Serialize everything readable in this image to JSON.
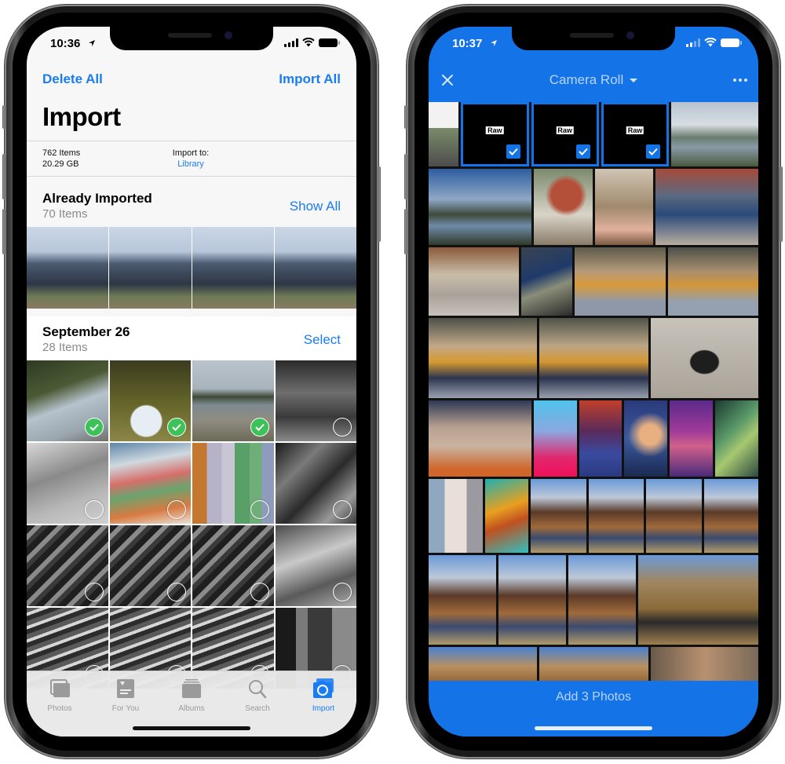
{
  "left_phone": {
    "status": {
      "time": "10:36",
      "location_icon": "location-arrow-icon"
    },
    "nav": {
      "left_label": "Delete All",
      "right_label": "Import All"
    },
    "title": "Import",
    "info": {
      "item_count": "762 Items",
      "size": "20.29 GB",
      "import_to_label": "Import to:",
      "import_to_value": "Library"
    },
    "already_imported": {
      "title": "Already Imported",
      "count": "70 Items",
      "action": "Show All",
      "thumbnails": [
        "family-group",
        "family-group",
        "family-group",
        "family-group"
      ]
    },
    "section": {
      "title": "September 26",
      "count": "28 Items",
      "action": "Select",
      "photos": [
        {
          "subject": "trees-sky",
          "selected": true
        },
        {
          "subject": "tree-canopy",
          "selected": true
        },
        {
          "subject": "lake-shore",
          "selected": true
        },
        {
          "subject": "bw-street",
          "selected": false
        },
        {
          "subject": "bw-market",
          "selected": false
        },
        {
          "subject": "macarons",
          "selected": false
        },
        {
          "subject": "macarons-top",
          "selected": false
        },
        {
          "subject": "bw-crowd",
          "selected": false
        },
        {
          "subject": "bw-hall",
          "selected": false
        },
        {
          "subject": "bw-hall",
          "selected": false
        },
        {
          "subject": "bw-hall",
          "selected": false
        },
        {
          "subject": "bw-hall-2",
          "selected": false
        },
        {
          "subject": "bw-hall-3",
          "selected": false
        },
        {
          "subject": "bw-hall-3",
          "selected": false
        },
        {
          "subject": "bw-hall-3",
          "selected": false
        },
        {
          "subject": "bw-shelf",
          "selected": false
        }
      ]
    },
    "tabs": [
      {
        "label": "Photos",
        "icon": "photos-icon",
        "active": false
      },
      {
        "label": "For You",
        "icon": "for-you-icon",
        "active": false
      },
      {
        "label": "Albums",
        "icon": "albums-icon",
        "active": false
      },
      {
        "label": "Search",
        "icon": "search-icon",
        "active": false
      },
      {
        "label": "Import",
        "icon": "camera-import-icon",
        "active": true
      }
    ]
  },
  "right_phone": {
    "status": {
      "time": "10:37",
      "location_icon": "location-arrow-icon"
    },
    "header": {
      "title": "Camera Roll",
      "close_icon": "close-icon",
      "more_icon": "more-icon"
    },
    "raw_label": "Raw",
    "footer": {
      "button_label": "Add 3 Photos"
    },
    "colors": {
      "brand_blue": "#1473e6",
      "ios_blue": "#1a7cf2",
      "check_green": "#3dc25a"
    }
  }
}
